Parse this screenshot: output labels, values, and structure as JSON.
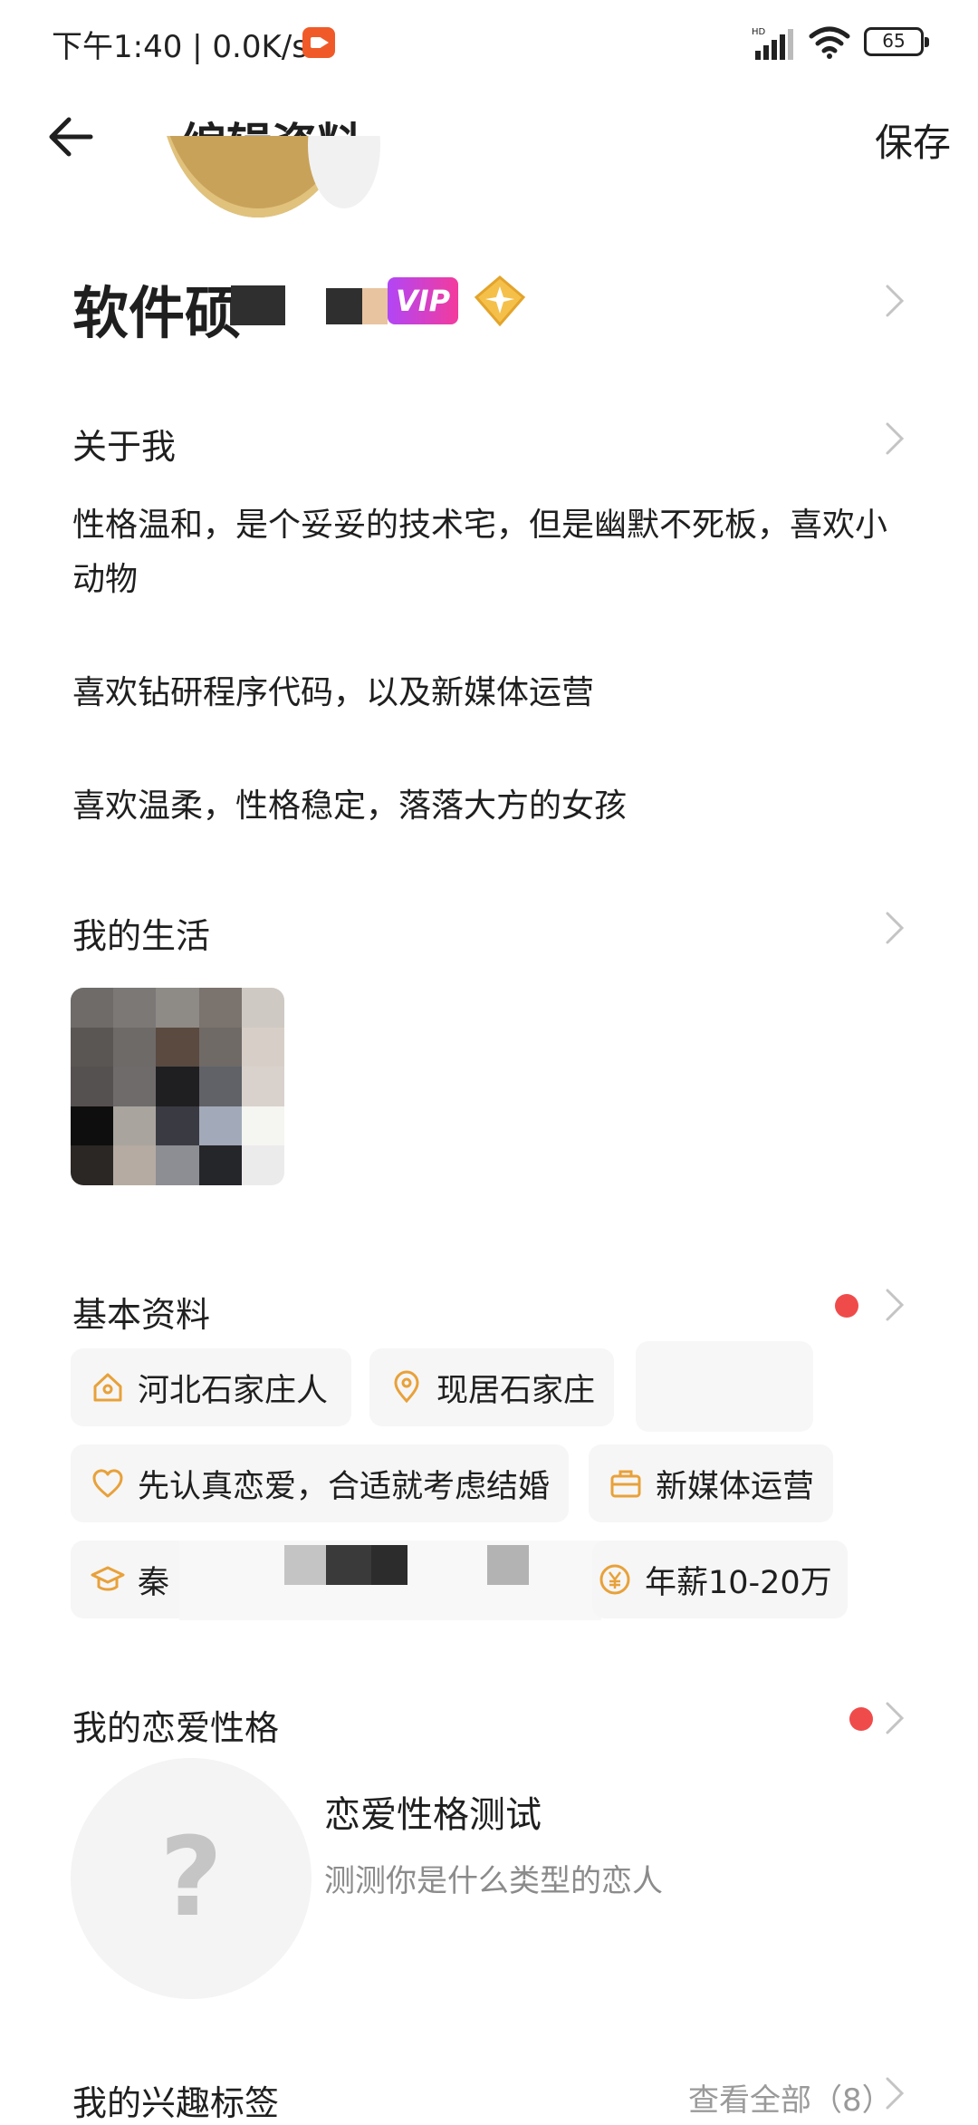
{
  "status_bar": {
    "time_speed": "下午1:40 | 0.0K/s",
    "battery": "65"
  },
  "header": {
    "title": "编辑资料",
    "save_label": "保存"
  },
  "profile": {
    "name_visible": "软件硕",
    "vip_label": "VIP"
  },
  "about": {
    "title": "关于我",
    "lines": [
      "性格温和，是个妥妥的技术宅，但是幽默不死板，喜欢小动物",
      "喜欢钻研程序代码，以及新媒体运营",
      "喜欢温柔，性格稳定，落落大方的女孩"
    ]
  },
  "life": {
    "title": "我的生活"
  },
  "basic": {
    "title": "基本资料",
    "tags": [
      {
        "label": "河北石家庄人",
        "icon": "hometown-icon"
      },
      {
        "label": "现居石家庄",
        "icon": "location-pin-icon"
      },
      {
        "label": "先认真恋爱，合适就考虑结婚",
        "icon": "heart-icon"
      },
      {
        "label": "新媒体运营",
        "icon": "briefcase-icon"
      },
      {
        "label": "秦",
        "icon": "graduation-cap-icon"
      },
      {
        "label": "年薪10-20万",
        "icon": "yen-icon"
      }
    ]
  },
  "love_personality": {
    "title": "我的恋爱性格",
    "test_title": "恋爱性格测试",
    "test_subtitle": "测测你是什么类型的恋人",
    "placeholder_glyph": "?"
  },
  "interests": {
    "title": "我的兴趣标签",
    "view_all": "查看全部（8）"
  },
  "colors": {
    "accent_icon": "#e8a13a",
    "red_dot": "#f04b4b",
    "tag_bg": "#f6f6f6",
    "vip_gradient_start": "#b146f6",
    "vip_gradient_end": "#f33b9d"
  }
}
